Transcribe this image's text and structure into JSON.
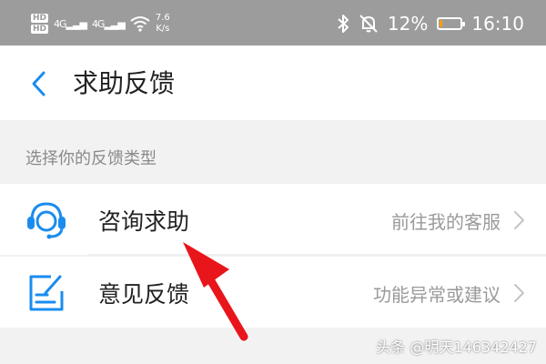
{
  "status_bar": {
    "hd_badges": [
      "HD",
      "HD"
    ],
    "signal_1": "4G",
    "signal_2": "4G",
    "speed_value": "7.6",
    "speed_unit": "K/s",
    "battery_percent": "12%",
    "battery_level": 0.12,
    "time": "16:10"
  },
  "header": {
    "title": "求助反馈",
    "back_icon": "chevron-left-icon"
  },
  "section": {
    "label": "选择你的反馈类型"
  },
  "items": [
    {
      "label": "咨询求助",
      "hint": "前往我的客服",
      "icon": "headset-agent-icon"
    },
    {
      "label": "意见反馈",
      "hint": "功能异常或建议",
      "icon": "edit-note-icon"
    }
  ],
  "watermark": "头条 @明天146342427",
  "colors": {
    "accent": "#1a8cf0",
    "arrow": "#e8161b",
    "status_bar_bg": "#9c9c9c",
    "battery_fill": "#f5a000"
  }
}
